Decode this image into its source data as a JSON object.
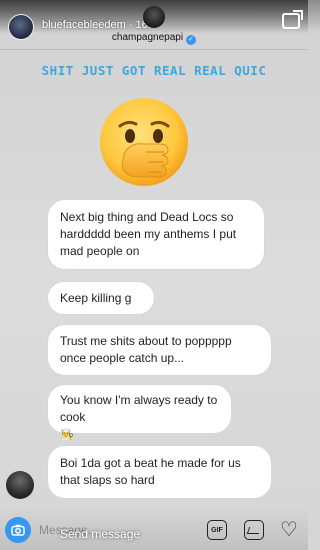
{
  "story": {
    "username": "bluefacebleedem · 16m"
  },
  "chat": {
    "name": "champagnepapi",
    "verified_mark": "✓"
  },
  "caption": "SHIT JUST GOT REAL REAL QUIC",
  "sticker": {
    "name": "face-with-hand-over-mouth-emoji"
  },
  "messages": [
    {
      "text": "Next big thing and Dead Locs so harddddd been my anthems I put mad people on"
    },
    {
      "text": "Keep killing g"
    },
    {
      "text": "Trust me shits about to poppppp once people catch up..."
    },
    {
      "text": "You know I'm always ready to cook",
      "emoji": "👨‍🍳"
    },
    {
      "text": "Boi 1da got a beat he made for us that slaps so hard"
    }
  ],
  "composer": {
    "placeholder": "Message...",
    "send_overlay": "Send message",
    "gif_label": "GIF",
    "heart_icon": "♡"
  },
  "colors": {
    "caption": "#3fa7e0",
    "camera_button": "#3897f0",
    "verified": "#3897f0"
  }
}
